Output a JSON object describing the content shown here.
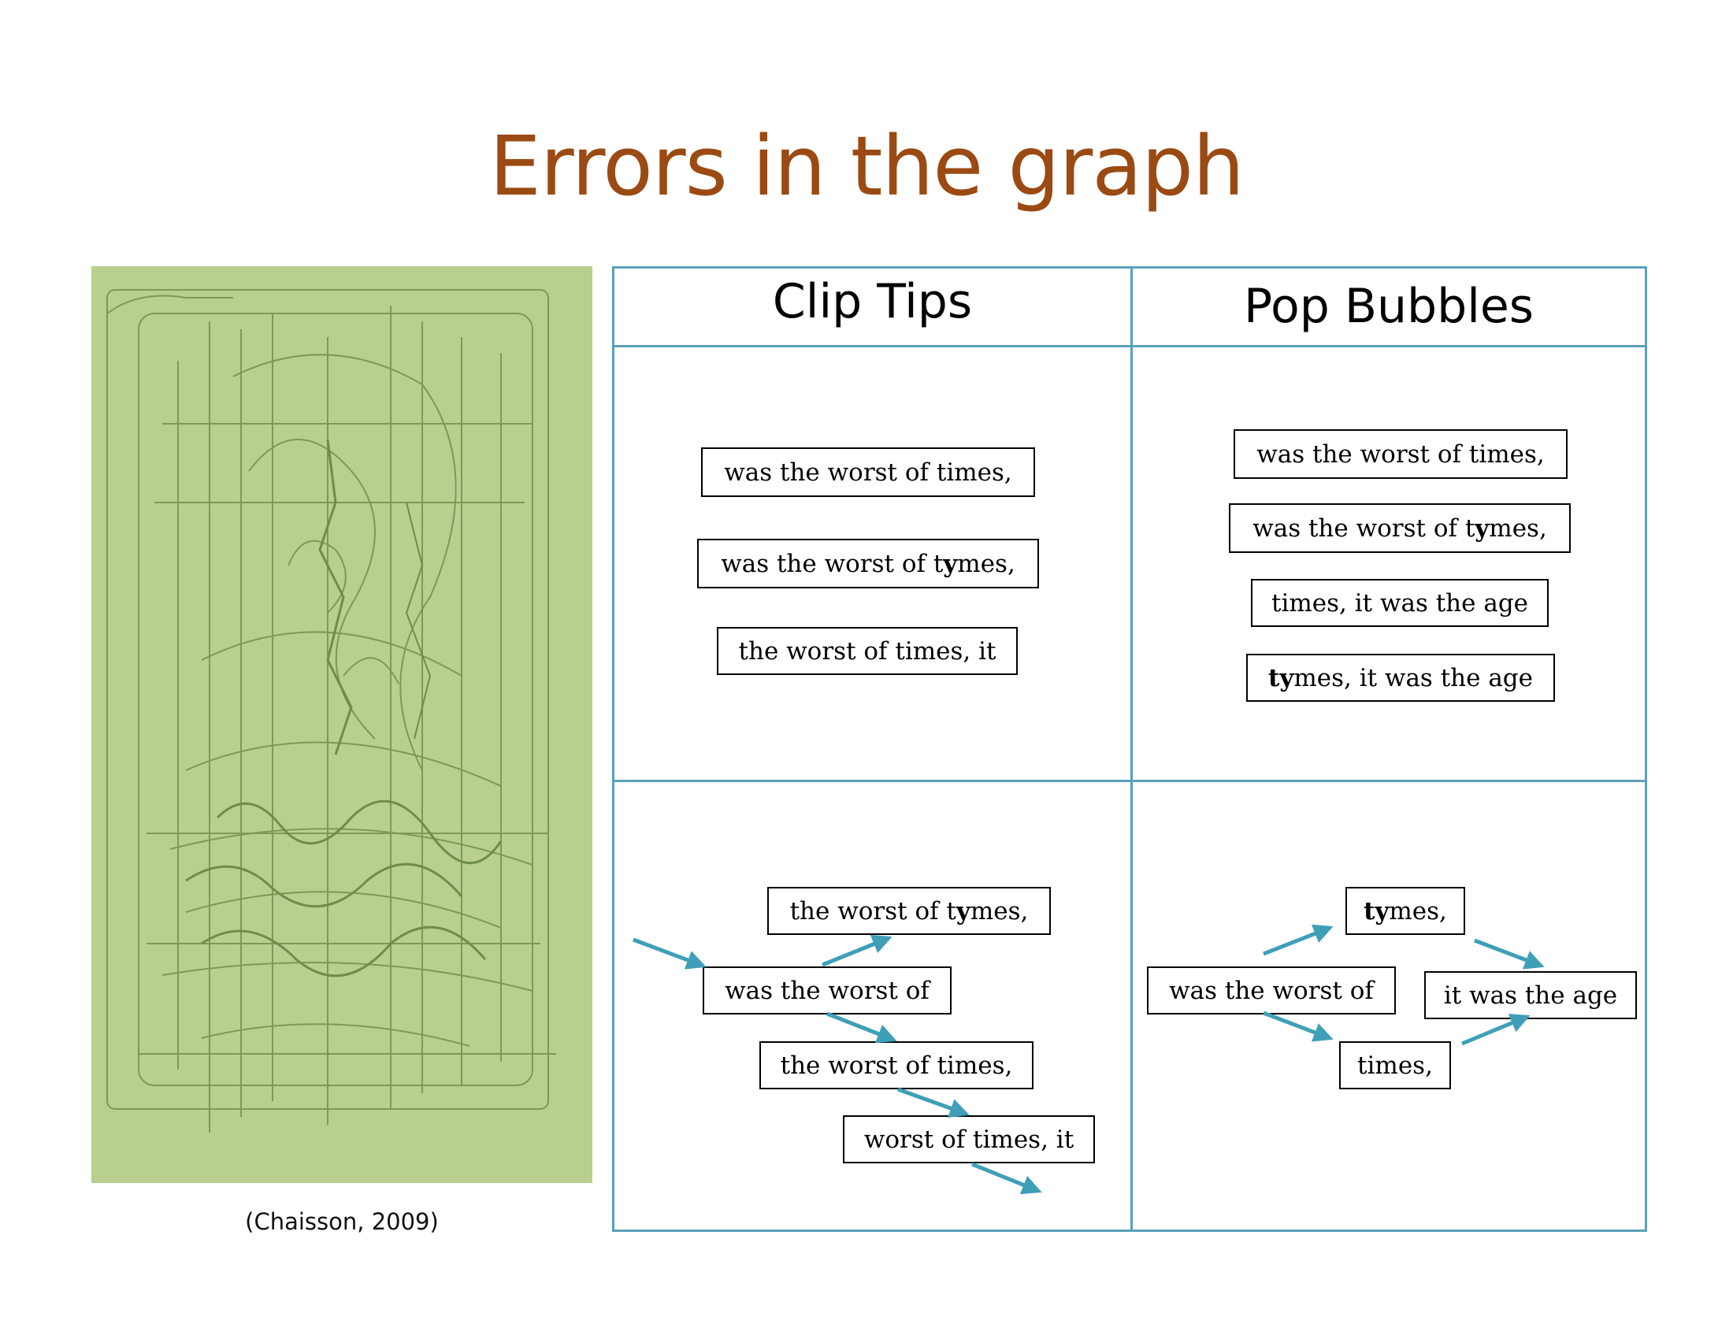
{
  "title": "Errors in the graph",
  "caption": "(Chaisson, 2009)",
  "headers": {
    "clip_tips": "Clip Tips",
    "pop_bubbles": "Pop Bubbles"
  },
  "clip_tips_top": [
    "was the worst of times,",
    "was the worst of tymes,",
    "the worst of times, it"
  ],
  "pop_bubbles_top": [
    "was the worst of times,",
    "was the worst of tymes,",
    "times, it was the age",
    "tymes, it was the age"
  ],
  "clip_tips_graph": [
    "the worst of tymes,",
    "was the worst of",
    "the worst of times,",
    "worst of times, it"
  ],
  "pop_bubbles_graph": [
    "tymes,",
    "was the worst of",
    "it was the age",
    "times,"
  ],
  "colors": {
    "title": "#9a4a12",
    "grid": "#5aa0bb",
    "arrow": "#3f9fb8",
    "image_bg": "#b8cf8e"
  }
}
